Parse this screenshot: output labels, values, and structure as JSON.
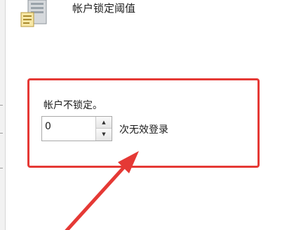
{
  "policy": {
    "title": "帐户锁定阈值",
    "icon": "server-policy-icon"
  },
  "setting": {
    "status_text": "帐户不锁定。",
    "threshold_value": "0",
    "unit_label": "次无效登录",
    "spin_up_icon": "triangle-up-icon",
    "spin_down_icon": "triangle-down-icon",
    "spin_up_glyph": "▲",
    "spin_down_glyph": "▼"
  },
  "annotation": {
    "highlight_color": "#e53935",
    "arrow_color": "#e53935"
  }
}
